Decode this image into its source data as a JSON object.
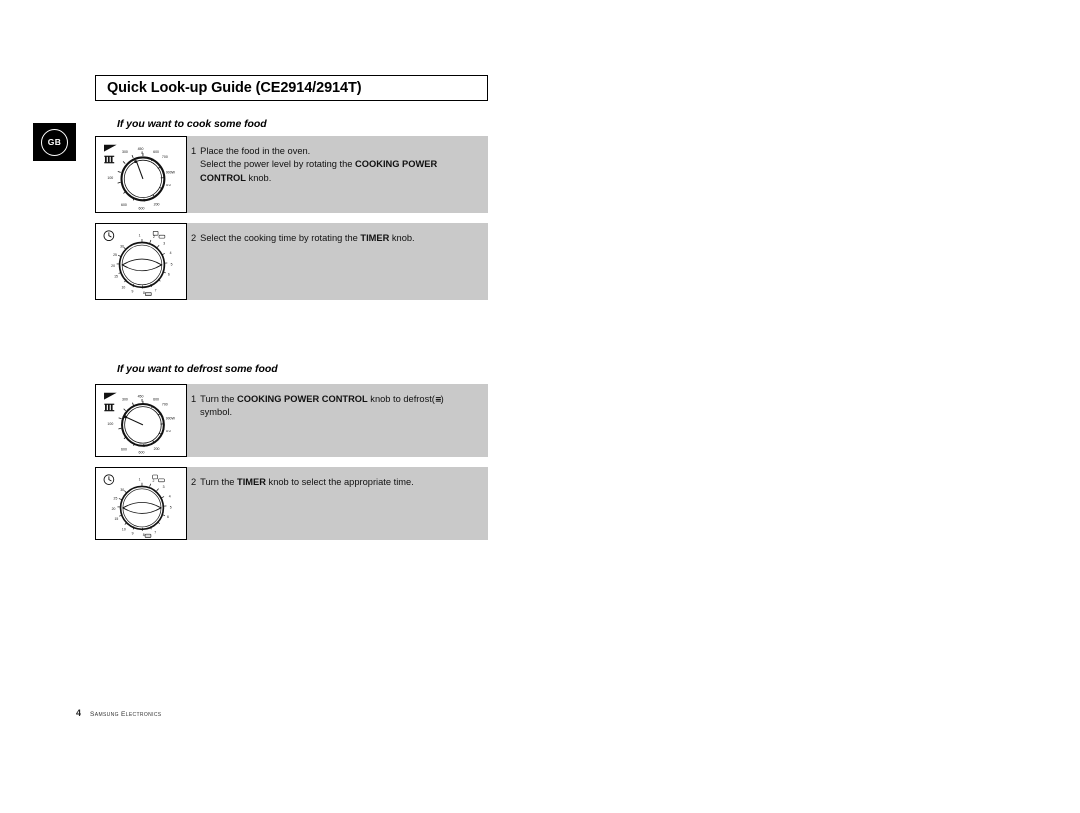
{
  "locale_badge": {
    "label": "GB"
  },
  "header": {
    "title": "Quick Look-up Guide (CE2914/2914T)"
  },
  "sections": [
    {
      "heading": "If you want to cook some food",
      "steps": [
        {
          "number": "1",
          "line1_a": "Place the food in the oven.",
          "line2_a": "Select the power level by  rotating the ",
          "line2_b": "COOKING POWER",
          "line3_b": "CONTROL",
          "line3_a": " knob.",
          "dial": "power-control-dial"
        },
        {
          "number": "2",
          "line1_a": "Select the cooking time by rotating the ",
          "line1_b": "TIMER",
          "line1_c": " knob.",
          "dial": "timer-dial"
        }
      ]
    },
    {
      "heading": "If you want to defrost some food",
      "steps": [
        {
          "number": "1",
          "line1_a": "Turn the ",
          "line1_b": "COOKING POWER CONTROL",
          "line1_c": " knob to defrost(",
          "line1_sym": "≡",
          "line1_d": ") ",
          "line2_a": "symbol.",
          "dial": "power-control-dial"
        },
        {
          "number": "2",
          "line1_a": "Turn the ",
          "line1_b": "TIMER",
          "line1_c": " knob to select the appropriate time.",
          "dial": "timer-dial"
        }
      ]
    }
  ],
  "power_dial": {
    "icon_top_left": "grill-flag-icon",
    "icon_defrost": "defrost-symbol-icon",
    "labels": [
      "300",
      "450",
      "600",
      "700",
      "900W",
      "100"
    ],
    "labels_bottom": [
      "600",
      "600",
      "200"
    ],
    "label_micro": "∪∪"
  },
  "timer_dial": {
    "icon_top_left": "clock-icon",
    "labels_right": [
      "1",
      "2",
      "3",
      "4",
      "5",
      "6"
    ],
    "labels_left": [
      "30",
      "25",
      "20",
      "15",
      "10"
    ],
    "labels_bottom": [
      "9",
      "8",
      "7"
    ]
  },
  "footer": {
    "page": "4",
    "brand": "Samsung Electronics"
  },
  "colors": {
    "panel": "#c9c9c9",
    "ink": "#000000",
    "paper": "#ffffff"
  }
}
